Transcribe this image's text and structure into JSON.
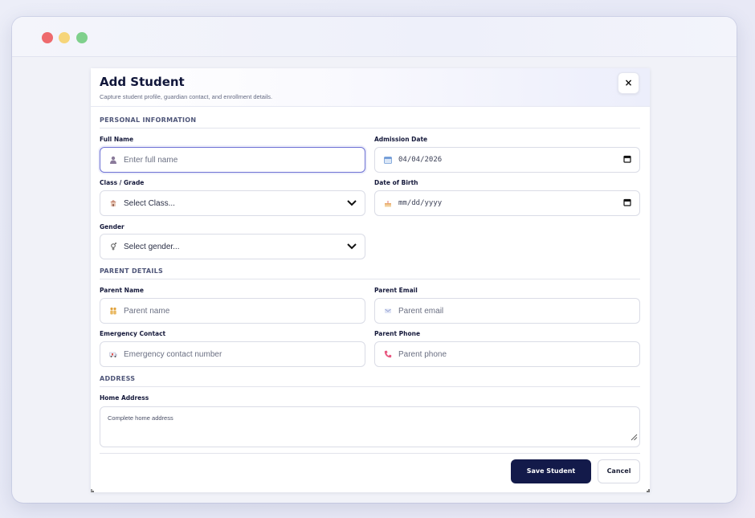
{
  "modal": {
    "title": "Add Student",
    "subtitle": "Capture student profile, guardian contact, and enrollment details.",
    "close_label": "×"
  },
  "sections": {
    "personal": "PERSONAL INFORMATION",
    "parent": "PARENT DETAILS",
    "address": "ADDRESS"
  },
  "fields": {
    "full_name": {
      "label": "Full Name",
      "placeholder": "Enter full name",
      "icon": "user-icon"
    },
    "admission_date": {
      "label": "Admission Date",
      "value": "04/04/2026",
      "icon": "calendar-icon"
    },
    "class_grade": {
      "label": "Class / Grade",
      "value": "Select Class...",
      "icon": "school-icon"
    },
    "date_of_birth": {
      "label": "Date of Birth",
      "value": "mm/dd/yyyy",
      "icon": "cake-icon"
    },
    "gender": {
      "label": "Gender",
      "value": "Select gender...",
      "icon": "gender-icon"
    },
    "parent_name": {
      "label": "Parent Name",
      "placeholder": "Parent name",
      "icon": "family-icon"
    },
    "parent_email": {
      "label": "Parent Email",
      "placeholder": "Parent email",
      "icon": "email-icon"
    },
    "emergency_contact": {
      "label": "Emergency Contact",
      "placeholder": "Emergency contact number",
      "icon": "ambulance-icon"
    },
    "parent_phone": {
      "label": "Parent Phone",
      "placeholder": "Parent phone",
      "icon": "phone-icon"
    },
    "home_address": {
      "label": "Home Address",
      "placeholder": "Complete home address"
    }
  },
  "actions": {
    "save": "Save Student",
    "cancel": "Cancel"
  },
  "colors": {
    "primary": "#131a4a",
    "focus_border": "#6e72d4",
    "window_dot_red": "#ee6a6d",
    "window_dot_yellow": "#f6d57a",
    "window_dot_green": "#7fd08c"
  }
}
